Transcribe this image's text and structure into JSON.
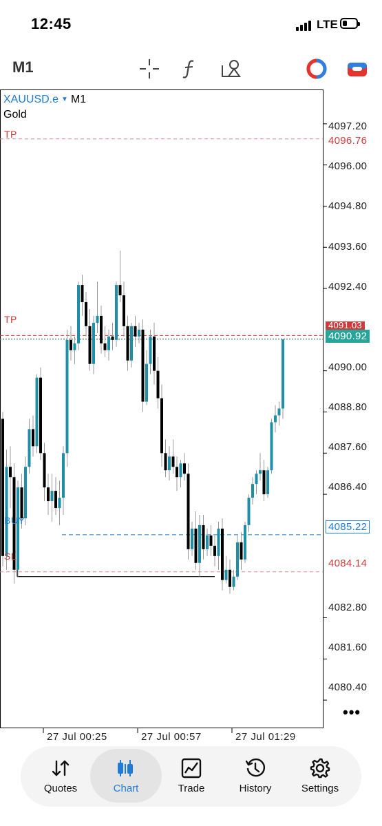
{
  "status_bar": {
    "time": "12:45",
    "network": "LTE"
  },
  "toolbar": {
    "timeframe": "M1",
    "icons": [
      "crosshair-icon",
      "indicators-icon",
      "objects-icon",
      "one-click-trading-icon",
      "account-icon"
    ]
  },
  "chart": {
    "symbol": "XAUUSD.e",
    "timeframe": "M1",
    "description": "Gold",
    "price_axis": [
      "4097.20",
      "4096.00",
      "4094.80",
      "4093.60",
      "4092.40",
      "4090.00",
      "4088.80",
      "4087.60",
      "4086.40",
      "4082.80",
      "4081.60",
      "4080.40"
    ],
    "lines": {
      "tp_upper": {
        "label": "TP",
        "price": "4096.76",
        "color": "#cf3b3b"
      },
      "tp_lower": {
        "label": "TP",
        "price": "4091.03",
        "color": "#cf3b3b"
      },
      "bid": {
        "price": "4090.92",
        "color": "#26a69a"
      },
      "buy": {
        "label": "BUY",
        "price": "4085.22",
        "color": "#1e7bd6"
      },
      "sl": {
        "label": "SL",
        "price": "4084.14",
        "color": "#cf3b3b"
      }
    },
    "time_axis": [
      "27 Jul 00:25",
      "27 Jul 00:57",
      "27 Jul 01:29"
    ],
    "more": "•••"
  },
  "chart_data": {
    "type": "candlestick",
    "symbol": "XAUUSD.e",
    "timeframe": "M1",
    "ylim": [
      4079.6,
      4098.2
    ],
    "x_tick_labels": [
      "27 Jul 00:25",
      "27 Jul 00:57",
      "27 Jul 01:29"
    ],
    "candles": [
      [
        4088.6,
        4088.8,
        4084.3,
        4084.6
      ],
      [
        4084.6,
        4087.7,
        4084.2,
        4087.2
      ],
      [
        4087.2,
        4087.8,
        4086.0,
        4086.9
      ],
      [
        4086.9,
        4087.3,
        4083.8,
        4084.2
      ],
      [
        4084.2,
        4086.8,
        4084.0,
        4086.6
      ],
      [
        4086.6,
        4087.0,
        4085.4,
        4085.7
      ],
      [
        4085.7,
        4087.5,
        4085.5,
        4087.2
      ],
      [
        4087.2,
        4088.6,
        4087.0,
        4088.3
      ],
      [
        4088.3,
        4088.7,
        4087.5,
        4087.8
      ],
      [
        4087.8,
        4089.9,
        4087.6,
        4089.8
      ],
      [
        4089.8,
        4090.1,
        4087.4,
        4087.6
      ],
      [
        4087.6,
        4087.9,
        4086.2,
        4086.6
      ],
      [
        4086.6,
        4087.0,
        4085.8,
        4086.2
      ],
      [
        4086.2,
        4087.0,
        4085.6,
        4086.5
      ],
      [
        4086.5,
        4086.9,
        4085.8,
        4086.0
      ],
      [
        4086.0,
        4086.8,
        4085.5,
        4086.3
      ],
      [
        4086.3,
        4087.8,
        4085.8,
        4087.6
      ],
      [
        4087.6,
        4091.2,
        4087.2,
        4090.9
      ],
      [
        4090.9,
        4091.3,
        4090.3,
        4090.6
      ],
      [
        4090.6,
        4091.0,
        4090.2,
        4090.8
      ],
      [
        4090.8,
        4092.6,
        4090.6,
        4092.5
      ],
      [
        4092.5,
        4092.8,
        4091.6,
        4092.0
      ],
      [
        4092.0,
        4092.3,
        4091.0,
        4091.3
      ],
      [
        4091.3,
        4091.8,
        4090.0,
        4090.2
      ],
      [
        4090.2,
        4091.6,
        4089.9,
        4091.4
      ],
      [
        4091.4,
        4092.6,
        4091.1,
        4091.6
      ],
      [
        4091.6,
        4091.9,
        4090.5,
        4090.8
      ],
      [
        4090.8,
        4091.3,
        4090.4,
        4090.6
      ],
      [
        4090.6,
        4091.2,
        4090.3,
        4091.0
      ],
      [
        4091.0,
        4091.4,
        4090.6,
        4090.9
      ],
      [
        4090.9,
        4092.6,
        4090.7,
        4092.5
      ],
      [
        4092.5,
        4093.5,
        4092.0,
        4092.2
      ],
      [
        4092.2,
        4092.6,
        4091.0,
        4091.3
      ],
      [
        4091.3,
        4091.6,
        4090.0,
        4090.3
      ],
      [
        4090.3,
        4091.4,
        4090.1,
        4091.3
      ],
      [
        4091.3,
        4091.6,
        4090.7,
        4091.0
      ],
      [
        4091.0,
        4091.4,
        4090.8,
        4091.2
      ],
      [
        4091.2,
        4091.5,
        4088.8,
        4089.1
      ],
      [
        4089.1,
        4090.6,
        4089.0,
        4090.2
      ],
      [
        4090.2,
        4091.2,
        4089.9,
        4091.0
      ],
      [
        4091.0,
        4091.4,
        4089.6,
        4090.0
      ],
      [
        4090.0,
        4090.4,
        4088.9,
        4089.2
      ],
      [
        4089.2,
        4089.6,
        4087.2,
        4087.6
      ],
      [
        4087.6,
        4088.0,
        4086.9,
        4087.1
      ],
      [
        4087.1,
        4087.8,
        4086.8,
        4087.5
      ],
      [
        4087.5,
        4088.0,
        4087.0,
        4087.2
      ],
      [
        4087.2,
        4087.5,
        4086.5,
        4086.9
      ],
      [
        4086.9,
        4087.4,
        4086.6,
        4087.3
      ],
      [
        4087.3,
        4087.6,
        4086.8,
        4087.0
      ],
      [
        4087.0,
        4087.3,
        4084.5,
        4084.8
      ],
      [
        4084.8,
        4085.6,
        4084.6,
        4085.4
      ],
      [
        4085.4,
        4085.9,
        4084.2,
        4084.4
      ],
      [
        4084.4,
        4085.8,
        4084.0,
        4085.5
      ],
      [
        4085.5,
        4085.8,
        4084.5,
        4084.8
      ],
      [
        4084.8,
        4085.4,
        4084.6,
        4085.2
      ],
      [
        4085.2,
        4085.5,
        4084.6,
        4084.9
      ],
      [
        4084.9,
        4085.2,
        4084.3,
        4084.6
      ],
      [
        4084.6,
        4085.6,
        4084.2,
        4085.4
      ],
      [
        4085.4,
        4085.7,
        4083.6,
        4083.9
      ],
      [
        4083.9,
        4084.6,
        4083.8,
        4084.2
      ],
      [
        4084.2,
        4084.5,
        4083.5,
        4083.7
      ],
      [
        4083.7,
        4084.2,
        4083.6,
        4084.0
      ],
      [
        4084.0,
        4085.2,
        4083.9,
        4085.0
      ],
      [
        4085.0,
        4085.3,
        4084.2,
        4084.5
      ],
      [
        4084.5,
        4085.6,
        4084.4,
        4085.5
      ],
      [
        4085.5,
        4086.4,
        4085.3,
        4086.3
      ],
      [
        4086.3,
        4086.9,
        4086.1,
        4086.7
      ],
      [
        4086.7,
        4087.1,
        4086.4,
        4087.0
      ],
      [
        4087.0,
        4087.6,
        4086.8,
        4087.1
      ],
      [
        4087.1,
        4087.4,
        4086.2,
        4086.4
      ],
      [
        4086.4,
        4087.2,
        4086.3,
        4087.1
      ],
      [
        4087.1,
        4088.6,
        4087.0,
        4088.5
      ],
      [
        4088.5,
        4089.0,
        4088.2,
        4088.7
      ],
      [
        4088.7,
        4089.1,
        4088.4,
        4088.9
      ],
      [
        4088.9,
        4090.9,
        4088.6,
        4090.92
      ]
    ],
    "candle_format": "[open, high, low, close]",
    "colors": {
      "up": "#1f8fa8",
      "down": "#000000"
    }
  },
  "tabs": [
    {
      "id": "quotes",
      "label": "Quotes",
      "icon": "quotes-icon",
      "active": false
    },
    {
      "id": "chart",
      "label": "Chart",
      "icon": "chart-icon",
      "active": true
    },
    {
      "id": "trade",
      "label": "Trade",
      "icon": "trade-icon",
      "active": false
    },
    {
      "id": "history",
      "label": "History",
      "icon": "history-icon",
      "active": false
    },
    {
      "id": "settings",
      "label": "Settings",
      "icon": "settings-icon",
      "active": false
    }
  ]
}
